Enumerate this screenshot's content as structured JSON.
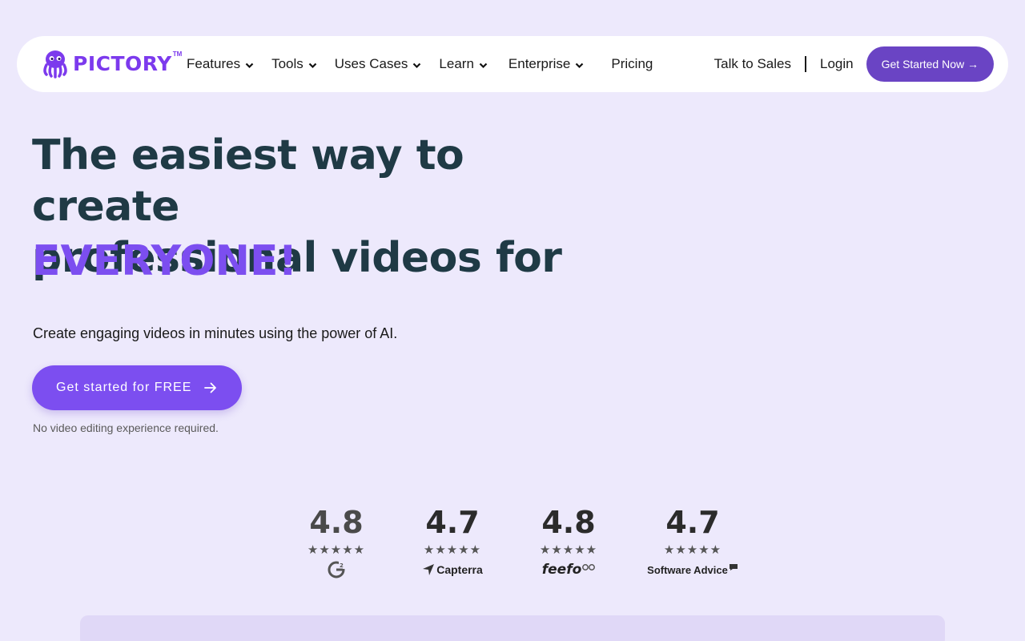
{
  "brand": {
    "name": "PICTORY",
    "tm": "TM",
    "color": "#7c3aed"
  },
  "nav": {
    "items": [
      {
        "label": "Features",
        "has_dropdown": true
      },
      {
        "label": "Tools",
        "has_dropdown": true
      },
      {
        "label": "Uses Cases",
        "has_dropdown": true
      },
      {
        "label": "Learn",
        "has_dropdown": true
      },
      {
        "label": "Enterprise",
        "has_dropdown": true
      },
      {
        "label": "Pricing",
        "has_dropdown": false
      }
    ],
    "talk_to_sales": "Talk to Sales",
    "login": "Login",
    "cta": "Get Started Now →"
  },
  "hero": {
    "title_line1": "The easiest way to create",
    "title_line2": "professional videos for",
    "title_accent": "EVERYONE!",
    "subtitle": "Create engaging videos in minutes using the power of AI.",
    "cta": "Get started for FREE",
    "note": "No video editing experience required."
  },
  "ratings": [
    {
      "score": "4.8",
      "stars": "★★★★★",
      "brand": "G2",
      "brand_icon": "g2-logo-icon"
    },
    {
      "score": "4.7",
      "stars": "★★★★★",
      "brand": "Capterra",
      "brand_icon": "capterra-logo-icon"
    },
    {
      "score": "4.8",
      "stars": "★★★★★",
      "brand": "feefo",
      "brand_icon": "feefo-logo-icon"
    },
    {
      "score": "4.7",
      "stars": "★★★★★",
      "brand": "Software Advice",
      "brand_icon": "software-advice-logo-icon"
    }
  ],
  "colors": {
    "background": "#ede9fc",
    "accent": "#7c4ef0",
    "nav_cta": "#6a44c4",
    "heading": "#1f3a45"
  }
}
